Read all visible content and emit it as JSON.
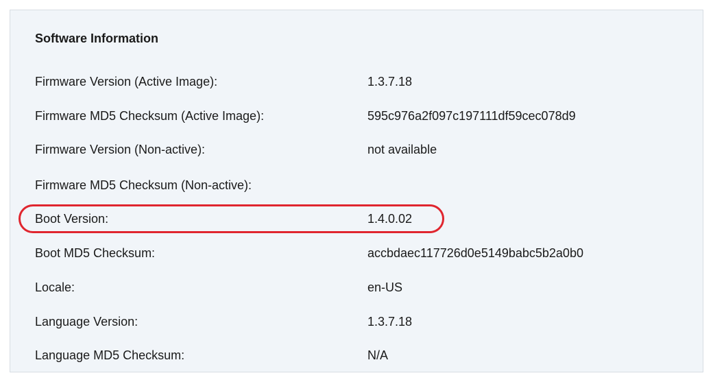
{
  "section": {
    "title": "Software Information"
  },
  "rows": [
    {
      "label": "Firmware Version (Active Image):",
      "value": "1.3.7.18"
    },
    {
      "label": "Firmware MD5 Checksum (Active Image):",
      "value": "595c976a2f097c197111df59cec078d9"
    },
    {
      "label": "Firmware Version (Non-active):",
      "value": "not available"
    },
    {
      "label": "Firmware MD5 Checksum (Non-active):",
      "value": ""
    },
    {
      "label": "Boot Version:",
      "value": "1.4.0.02"
    },
    {
      "label": "Boot MD5 Checksum:",
      "value": "accbdaec117726d0e5149babc5b2a0b0"
    },
    {
      "label": "Locale:",
      "value": "en-US"
    },
    {
      "label": "Language Version:",
      "value": "1.3.7.18"
    },
    {
      "label": "Language MD5 Checksum:",
      "value": "N/A"
    }
  ],
  "colors": {
    "panel_background": "#f1f5f9",
    "text": "#1a1a1a",
    "highlight": "#e0262f"
  }
}
